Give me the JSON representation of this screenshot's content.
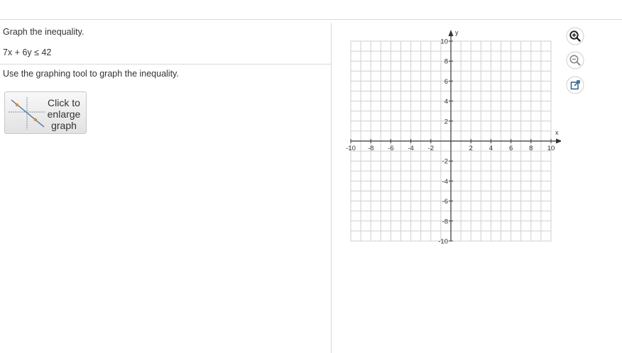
{
  "question": {
    "title": "Graph the inequality.",
    "inequality": "7x + 6y ≤ 42",
    "instruction": "Use the graphing tool to graph the inequality."
  },
  "enlarge_button": {
    "label": "Click to\nenlarge\ngraph"
  },
  "graph": {
    "x_axis_label": "x",
    "y_axis_label": "y",
    "x_range": [
      -10,
      10
    ],
    "y_range": [
      -10,
      10
    ],
    "grid_step": 1,
    "tick_step": 2,
    "x_tick_labels": [
      "-10",
      "-8",
      "-6",
      "-4",
      "-2",
      "2",
      "4",
      "6",
      "8",
      "10"
    ],
    "y_tick_labels": [
      "10",
      "8",
      "6",
      "4",
      "2",
      "-2",
      "-4",
      "-6",
      "-8",
      "-10"
    ],
    "grid_color": "#cfcfcf",
    "axis_color": "#333333"
  },
  "toolbar": {
    "zoom_in_icon": "zoom-in-icon",
    "zoom_out_icon": "zoom-out-icon",
    "popout_icon": "popout-icon",
    "accent_color": "#2e5f8a"
  }
}
